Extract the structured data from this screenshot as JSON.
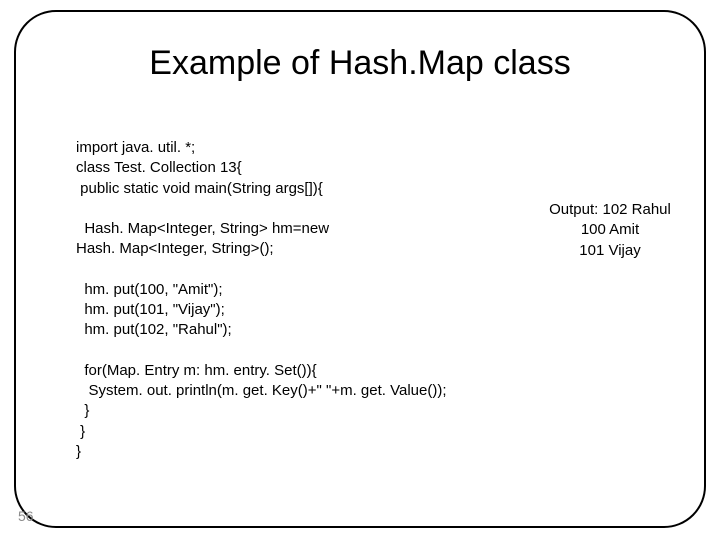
{
  "title": "Example of Hash.Map class",
  "code": "import java. util. *;\nclass Test. Collection 13{\n public static void main(String args[]){\n\n  Hash. Map<Integer, String> hm=new\nHash. Map<Integer, String>();\n\n  hm. put(100, \"Amit\");\n  hm. put(101, \"Vijay\");\n  hm. put(102, \"Rahul\");\n\n  for(Map. Entry m: hm. entry. Set()){\n   System. out. println(m. get. Key()+\" \"+m. get. Value());\n  }\n }\n}",
  "output": {
    "line1": "Output: 102 Rahul",
    "line2": "100 Amit",
    "line3": "101 Vijay"
  },
  "page_number": "56"
}
